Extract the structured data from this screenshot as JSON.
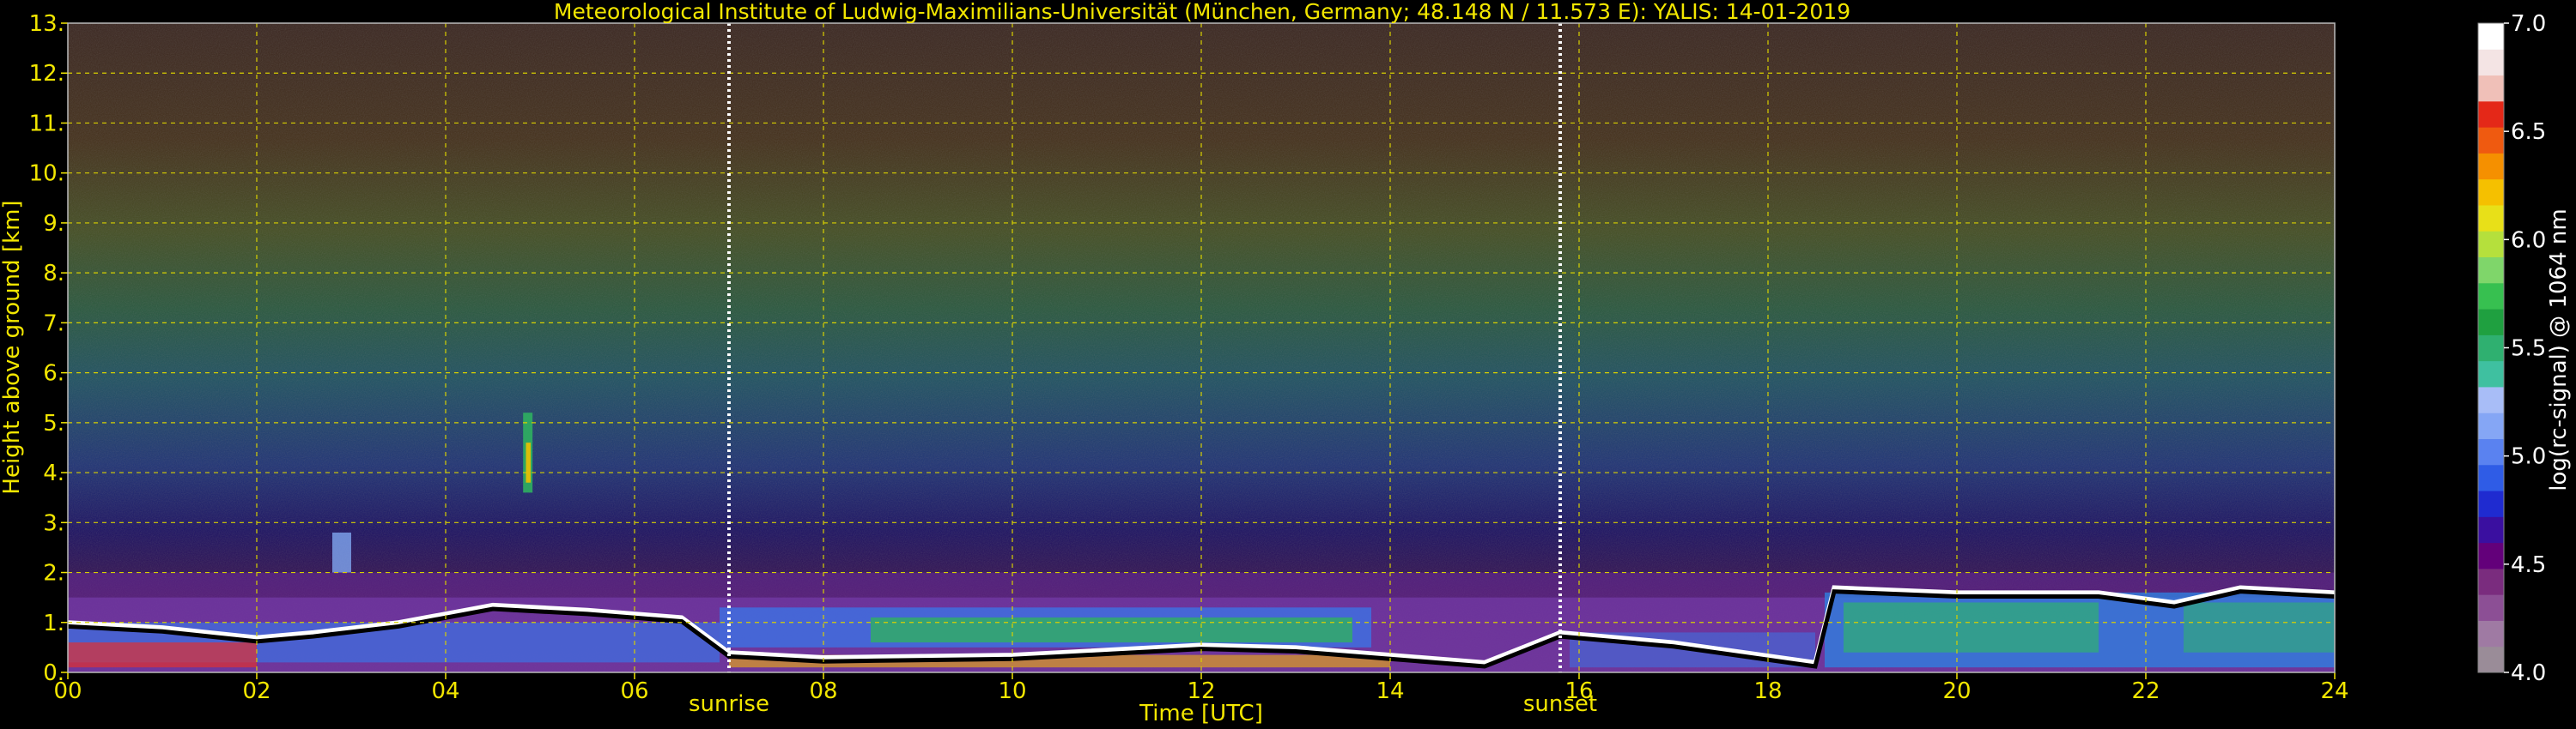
{
  "chart_data": {
    "type": "heatmap",
    "title": "Meteorological Institute of Ludwig-Maximilians-Universität (München, Germany; 48.148 N / 11.573 E):    YALIS: 14-01-2019",
    "xlabel": "Time [UTC]",
    "ylabel": "Height above ground [km]",
    "xlim": [
      0,
      24
    ],
    "ylim": [
      0,
      13
    ],
    "x_ticks": [
      0,
      2,
      4,
      6,
      8,
      10,
      12,
      14,
      16,
      18,
      20,
      22,
      24
    ],
    "x_tick_labels": [
      "00",
      "02",
      "04",
      "06",
      "08",
      "10",
      "12",
      "14",
      "16",
      "18",
      "20",
      "22",
      "24"
    ],
    "y_ticks": [
      0,
      1,
      2,
      3,
      4,
      5,
      6,
      7,
      8,
      9,
      10,
      11,
      12,
      13
    ],
    "y_tick_labels": [
      "0.",
      "1.",
      "2.",
      "3.",
      "4.",
      "5.",
      "6.",
      "7.",
      "8.",
      "9.",
      "10.",
      "11.",
      "12.",
      "13."
    ],
    "grid": true,
    "annotations": [
      {
        "text": "sunrise",
        "x": 7.0
      },
      {
        "text": "sunset",
        "x": 15.8
      }
    ],
    "colorbar": {
      "label": "log(rc-signal) @ 1064 nm",
      "range": [
        4.0,
        7.0
      ],
      "ticks": [
        4.0,
        4.5,
        5.0,
        5.5,
        6.0,
        6.5,
        7.0
      ],
      "tick_labels": [
        "4.0",
        "4.5",
        "5.0",
        "5.5",
        "6.0",
        "6.5",
        "7.0"
      ],
      "colors": [
        "#9a8c98",
        "#9f7aa3",
        "#8c4f95",
        "#7a2c7e",
        "#63007a",
        "#3a0fa0",
        "#1f2bd0",
        "#2f5ce6",
        "#5a82f0",
        "#85a6f5",
        "#a8bdf7",
        "#3fc0a0",
        "#2fb070",
        "#1fa040",
        "#37c050",
        "#7fd66a",
        "#b5e03c",
        "#e8e018",
        "#f5c000",
        "#f59000",
        "#ef5a10",
        "#e42818",
        "#f0c0b8",
        "#f4e4e4",
        "#ffffff"
      ]
    }
  }
}
